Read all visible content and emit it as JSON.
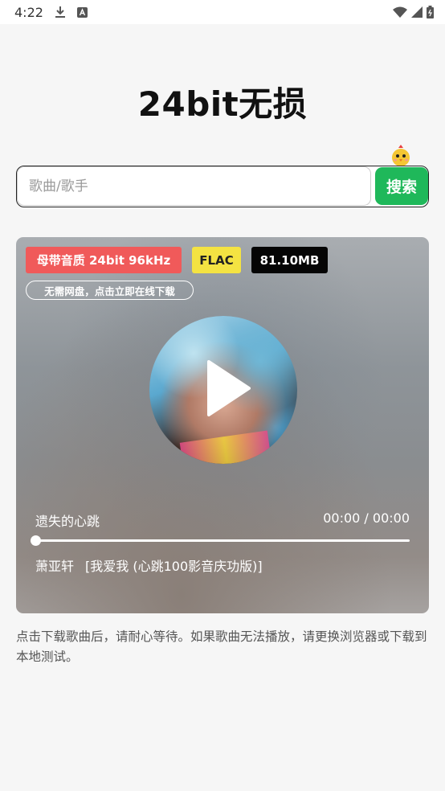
{
  "status_bar": {
    "time": "4:22",
    "icons": [
      "download-icon",
      "keyboard-a-icon",
      "wifi-icon",
      "signal-icon",
      "battery-icon"
    ]
  },
  "header": {
    "title": "24bit无损"
  },
  "search": {
    "placeholder": "歌曲/歌手",
    "value": "",
    "button_label": "搜索"
  },
  "player": {
    "tags": {
      "quality": "母带音质 24bit 96kHz",
      "format": "FLAC",
      "size": "81.10MB"
    },
    "badge": "无需网盘，点击立即在线下载",
    "song_title": "遗失的心跳",
    "time": "00:00 / 00:00",
    "progress": 0,
    "artist": "萧亚轩",
    "album": "[我爱我 (心跳100影音庆功版)]"
  },
  "note": "点击下载歌曲后，请耐心等待。如果歌曲无法播放，请更换浏览器或下载到本地测试。",
  "colors": {
    "accent_green": "#1fb85a",
    "quality_tag": "#f05a5a",
    "format_tag": "#f4e342",
    "size_tag": "#050505"
  }
}
